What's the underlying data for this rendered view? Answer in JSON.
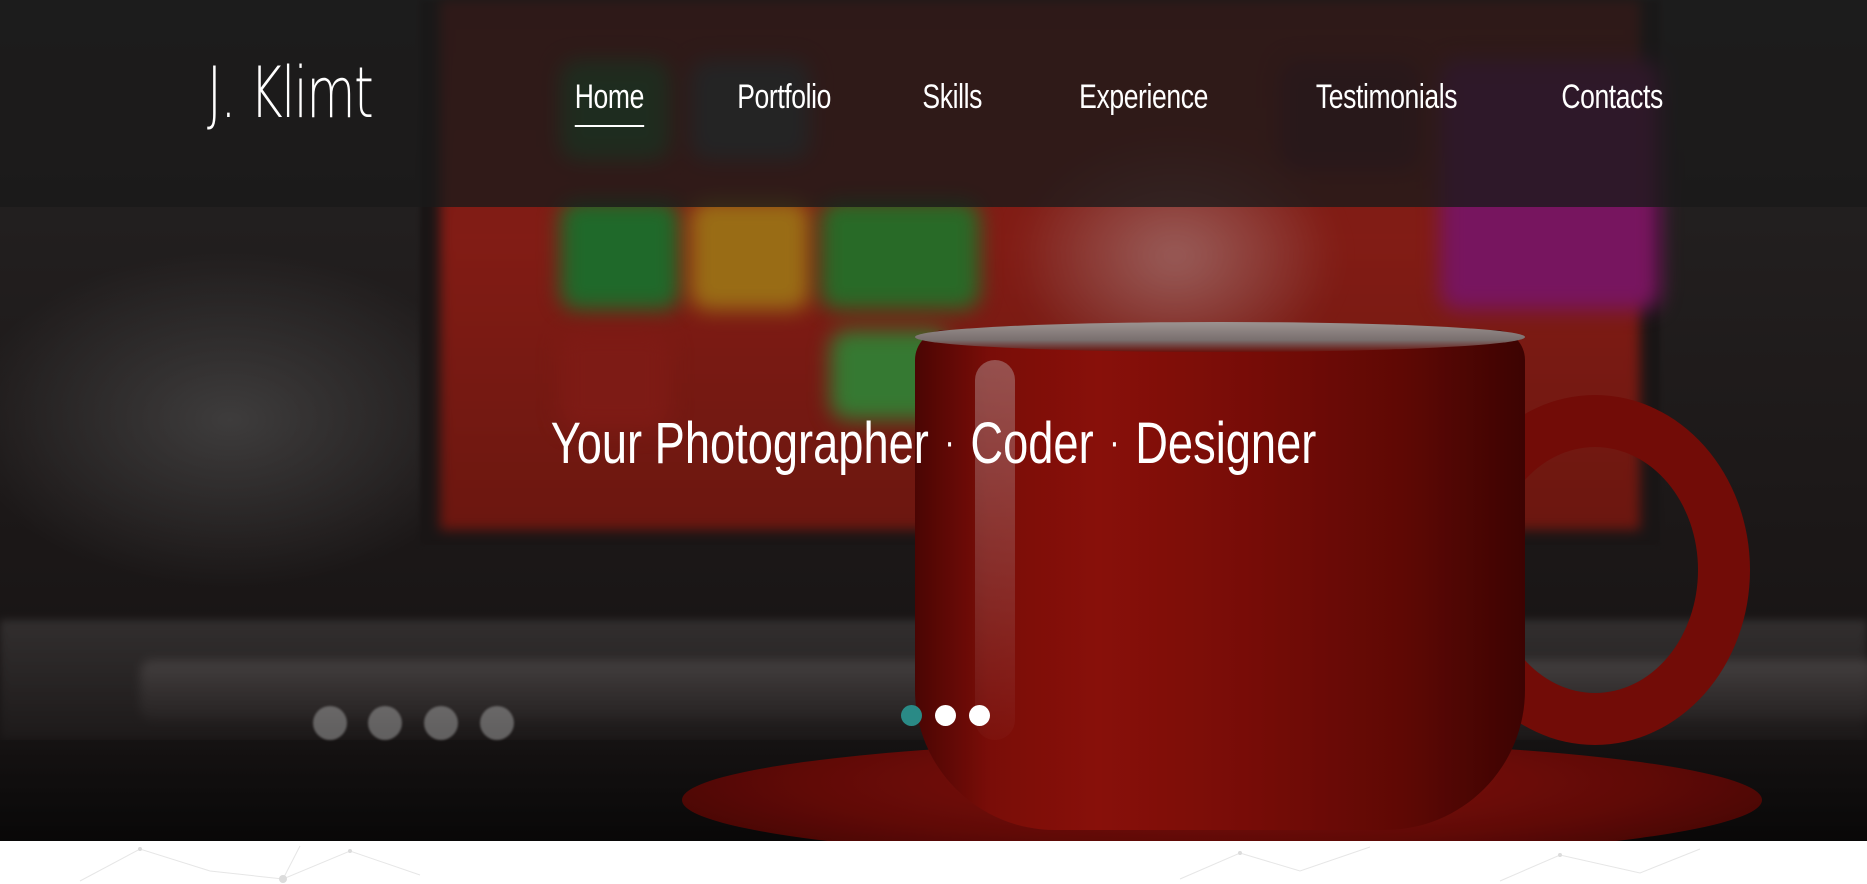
{
  "brand": {
    "logo_text": "J. Klimt"
  },
  "nav": {
    "items": [
      {
        "label": "Home",
        "active": true
      },
      {
        "label": "Portfolio",
        "active": false
      },
      {
        "label": "Skills",
        "active": false
      },
      {
        "label": "Experience",
        "active": false
      },
      {
        "label": "Testimonials",
        "active": false
      },
      {
        "label": "Contacts",
        "active": false
      }
    ]
  },
  "hero": {
    "tagline_parts": [
      "Your Photographer",
      "Coder",
      "Designer"
    ],
    "separator": "·",
    "slides": {
      "count": 3,
      "active_index": 0
    }
  },
  "colors": {
    "navbar_bg": "#191919",
    "slider_active": "#2a8a86",
    "slider_inactive": "#ffffff",
    "text": "#ffffff"
  }
}
